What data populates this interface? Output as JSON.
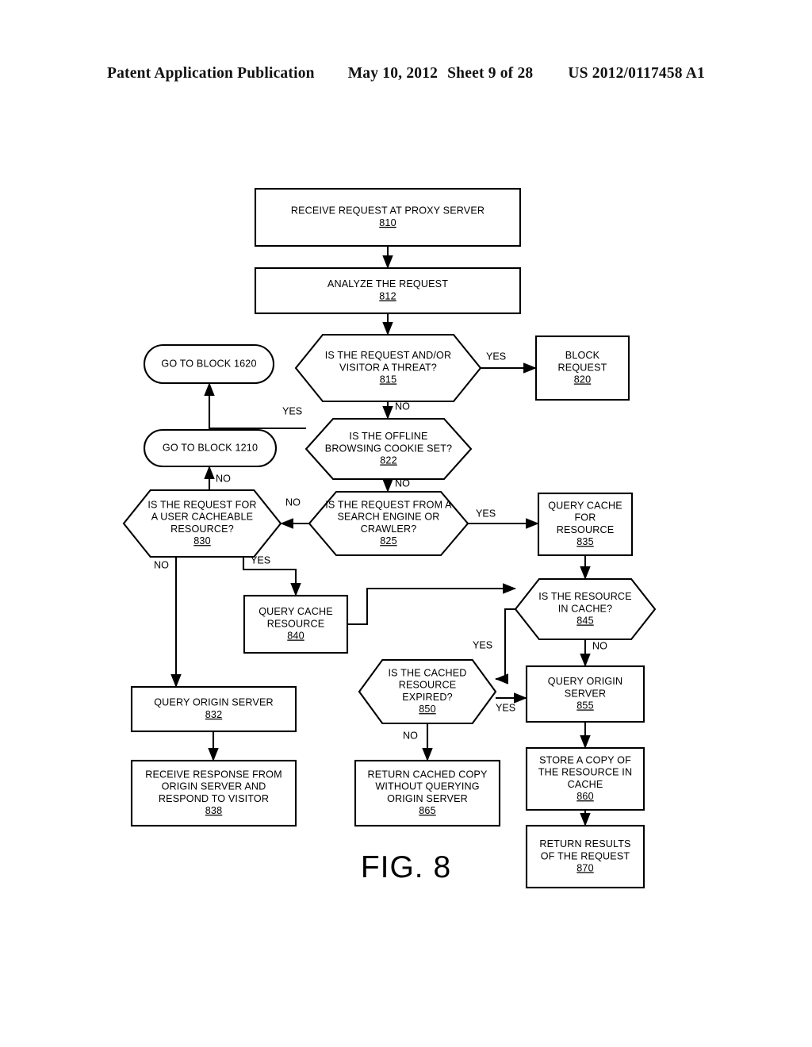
{
  "header": {
    "publication": "Patent Application Publication",
    "date": "May 10, 2012",
    "sheet": "Sheet 9 of 28",
    "number": "US 2012/0117458 A1"
  },
  "figure": {
    "caption": "FIG. 8",
    "stroke_color": "#000000",
    "fill_color": "#ffffff"
  },
  "chart_data": {
    "type": "diagram",
    "title": "FIG. 8",
    "nodes": [
      {
        "id": "810",
        "shape": "rect",
        "ref": "810",
        "lines": [
          "RECEIVE REQUEST AT PROXY SERVER"
        ]
      },
      {
        "id": "812",
        "shape": "rect",
        "ref": "812",
        "lines": [
          "ANALYZE THE REQUEST"
        ]
      },
      {
        "id": "815",
        "shape": "hexagon",
        "ref": "815",
        "lines": [
          "IS THE REQUEST AND/OR",
          "VISITOR A THREAT?"
        ]
      },
      {
        "id": "820",
        "shape": "rect",
        "ref": "820",
        "lines": [
          "BLOCK",
          "REQUEST"
        ]
      },
      {
        "id": "1620",
        "shape": "pill",
        "ref": "",
        "lines": [
          "GO TO BLOCK 1620"
        ]
      },
      {
        "id": "822",
        "shape": "hexagon",
        "ref": "822",
        "lines": [
          "IS THE OFFLINE",
          "BROWSING COOKIE SET?"
        ]
      },
      {
        "id": "1210",
        "shape": "pill",
        "ref": "",
        "lines": [
          "GO TO BLOCK 1210"
        ]
      },
      {
        "id": "830",
        "shape": "hexagon",
        "ref": "830",
        "lines": [
          "IS THE REQUEST FOR",
          "A USER CACHEABLE",
          "RESOURCE?"
        ]
      },
      {
        "id": "825",
        "shape": "hexagon",
        "ref": "825",
        "lines": [
          "IS THE REQUEST FROM A",
          "SEARCH ENGINE OR",
          "CRAWLER?"
        ]
      },
      {
        "id": "835",
        "shape": "rect",
        "ref": "835",
        "lines": [
          "QUERY CACHE",
          "FOR",
          "RESOURCE"
        ]
      },
      {
        "id": "840",
        "shape": "rect",
        "ref": "840",
        "lines": [
          "QUERY CACHE",
          "RESOURCE"
        ]
      },
      {
        "id": "845",
        "shape": "hexagon",
        "ref": "845",
        "lines": [
          "IS THE RESOURCE",
          "IN CACHE?"
        ]
      },
      {
        "id": "850",
        "shape": "hexagon",
        "ref": "850",
        "lines": [
          "IS THE CACHED",
          "RESOURCE",
          "EXPIRED?"
        ]
      },
      {
        "id": "855",
        "shape": "rect",
        "ref": "855",
        "lines": [
          "QUERY ORIGIN",
          "SERVER"
        ]
      },
      {
        "id": "832",
        "shape": "rect",
        "ref": "832",
        "lines": [
          "QUERY ORIGIN SERVER"
        ]
      },
      {
        "id": "838",
        "shape": "rect",
        "ref": "838",
        "lines": [
          "RECEIVE RESPONSE FROM",
          "ORIGIN SERVER AND",
          "RESPOND TO VISITOR"
        ]
      },
      {
        "id": "865",
        "shape": "rect",
        "ref": "865",
        "lines": [
          "RETURN CACHED COPY",
          "WITHOUT QUERYING",
          "ORIGIN SERVER"
        ]
      },
      {
        "id": "860",
        "shape": "rect",
        "ref": "860",
        "lines": [
          "STORE A COPY OF",
          "THE RESOURCE IN",
          "CACHE"
        ]
      },
      {
        "id": "870",
        "shape": "rect",
        "ref": "870",
        "lines": [
          "RETURN RESULTS",
          "OF THE REQUEST"
        ]
      }
    ],
    "edges": [
      {
        "from": "810",
        "to": "812",
        "label": ""
      },
      {
        "from": "812",
        "to": "815",
        "label": ""
      },
      {
        "from": "815",
        "to": "820",
        "label": "YES"
      },
      {
        "from": "815",
        "to": "822",
        "label": "NO"
      },
      {
        "from": "822",
        "to": "1620",
        "label": "YES"
      },
      {
        "from": "822",
        "to": "825",
        "label": "NO"
      },
      {
        "from": "825",
        "to": "835",
        "label": "YES"
      },
      {
        "from": "825",
        "to": "830",
        "label": "NO"
      },
      {
        "from": "830",
        "to": "1210",
        "label": "NO"
      },
      {
        "from": "830",
        "to": "832",
        "label": "NO"
      },
      {
        "from": "830",
        "to": "840",
        "label": "YES"
      },
      {
        "from": "835",
        "to": "845",
        "label": ""
      },
      {
        "from": "840",
        "to": "845",
        "label": ""
      },
      {
        "from": "845",
        "to": "850",
        "label": "YES"
      },
      {
        "from": "845",
        "to": "855",
        "label": "NO"
      },
      {
        "from": "850",
        "to": "855",
        "label": "YES"
      },
      {
        "from": "850",
        "to": "865",
        "label": "NO"
      },
      {
        "from": "832",
        "to": "838",
        "label": ""
      },
      {
        "from": "855",
        "to": "860",
        "label": ""
      },
      {
        "from": "860",
        "to": "870",
        "label": ""
      }
    ],
    "edge_labels": [
      "YES",
      "NO"
    ]
  }
}
